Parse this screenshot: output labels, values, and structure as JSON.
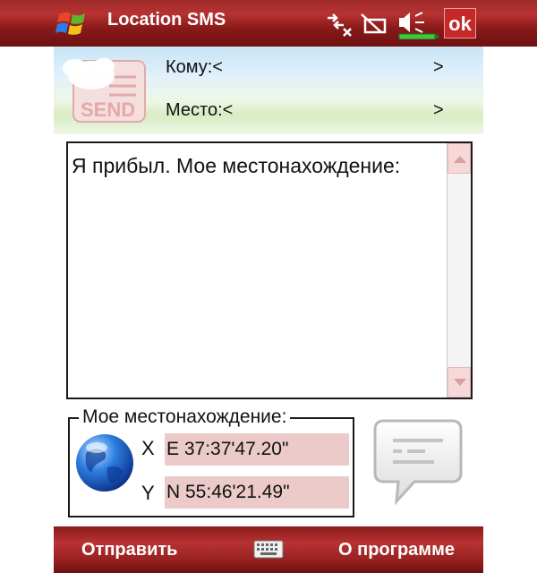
{
  "titlebar": {
    "title": "Location SMS",
    "ok_label": "ok",
    "icons": [
      "windows-start-icon",
      "connectivity-icon",
      "phone-signal-off-icon",
      "volume-icon",
      "battery-icon"
    ]
  },
  "header": {
    "to_label": "Кому:<",
    "to_arrow": ">",
    "place_label": "Место:<",
    "place_arrow": ">",
    "logo_text": "SEND"
  },
  "message": {
    "text": "Я прибыл. Мое местонахождение:"
  },
  "location": {
    "legend": "Мое местонахождение:",
    "x_label": "X",
    "x_value": "E 37:37'47.20\"",
    "y_label": "Y",
    "y_value": "N 55:46'21.49\""
  },
  "menu": {
    "left": "Отправить",
    "right": "О программе"
  },
  "colors": {
    "bar_red": "#9e2a2a",
    "coord_bg": "#eccaca",
    "ok_bg": "#c62828"
  }
}
